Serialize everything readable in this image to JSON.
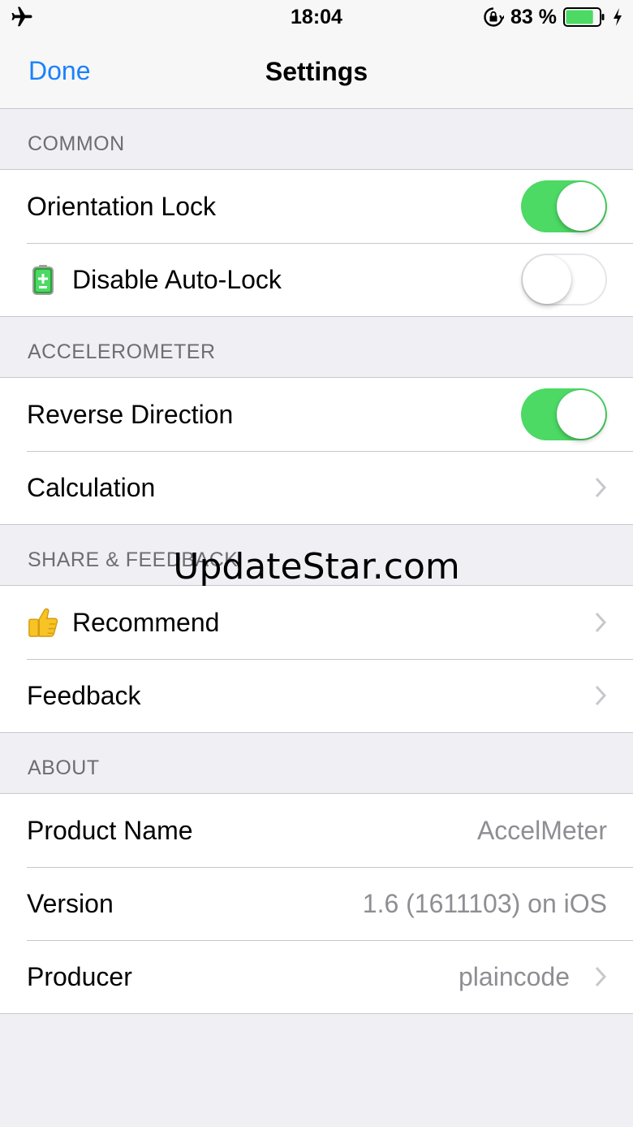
{
  "status_bar": {
    "time": "18:04",
    "battery_percent": "83 %",
    "battery_level": 0.83,
    "icons": [
      "airplane-icon",
      "rotation-lock-icon",
      "battery-icon",
      "charging-bolt-icon"
    ]
  },
  "nav": {
    "done_label": "Done",
    "title": "Settings"
  },
  "sections": {
    "common": {
      "header": "COMMON",
      "orientation_lock": {
        "label": "Orientation Lock",
        "on": true
      },
      "disable_auto_lock": {
        "label": "Disable Auto-Lock",
        "on": false,
        "icon": "battery-charging-icon"
      }
    },
    "accelerometer": {
      "header": "ACCELEROMETER",
      "reverse_direction": {
        "label": "Reverse Direction",
        "on": true
      },
      "calculation": {
        "label": "Calculation"
      }
    },
    "share": {
      "header": "SHARE & FEEDBACK",
      "recommend": {
        "label": "Recommend",
        "icon": "thumbs-up-icon"
      },
      "feedback": {
        "label": "Feedback"
      }
    },
    "about": {
      "header": "ABOUT",
      "product_name": {
        "label": "Product Name",
        "value": "AccelMeter"
      },
      "version": {
        "label": "Version",
        "value": "1.6 (1611103) on iOS"
      },
      "producer": {
        "label": "Producer",
        "value": "plaincode"
      }
    }
  },
  "watermark": "UpdateStar.com",
  "colors": {
    "accent": "#1a82fb",
    "toggle_on": "#4cd964",
    "background": "#efeff4",
    "secondary_text": "#8e8e93"
  }
}
